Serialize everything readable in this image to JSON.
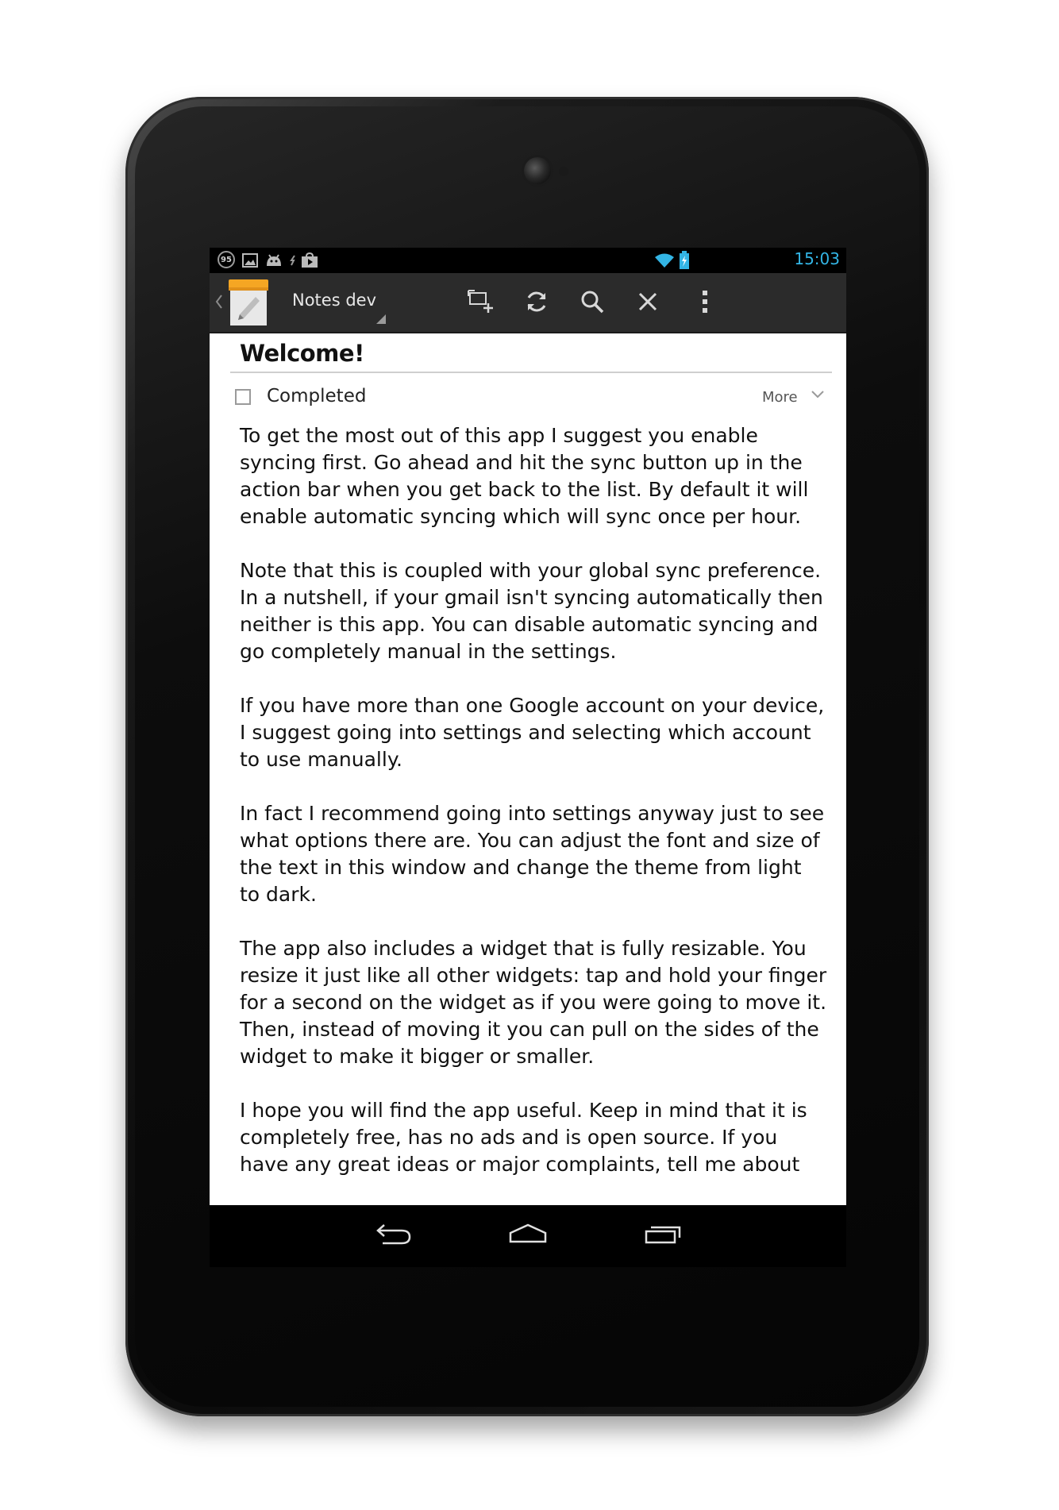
{
  "status_bar": {
    "notification_count": "95",
    "clock": "15:03",
    "icons": [
      "notification-count-icon",
      "image-icon",
      "android-icon",
      "usb-icon",
      "store-icon",
      "wifi-icon",
      "battery-charging-icon"
    ]
  },
  "action_bar": {
    "title": "Notes dev",
    "icons": [
      "back-chevron-icon",
      "notes-app-icon",
      "new-note-icon",
      "sync-icon",
      "search-icon",
      "close-icon",
      "overflow-menu-icon"
    ]
  },
  "note": {
    "title": "Welcome!",
    "completed_label": "Completed",
    "completed_checked": false,
    "more_label": "More",
    "paragraphs": [
      "To get the most out of this app I suggest you enable syncing first. Go ahead and hit the sync button up in the action bar when you get back to the list. By default it will enable automatic syncing which will sync once per hour.",
      "Note that this is coupled with your global sync preference. In a nutshell, if your gmail isn't syncing automatically then neither is this app. You can disable automatic syncing and go completely manual in the settings.",
      "If you have more than one Google account on your device, I suggest going into settings and selecting which account to use manually.",
      "In fact I recommend going into settings anyway just to see what options there are. You can adjust the font and size of the text in this window and change the theme from light to dark.",
      "The app also includes a widget that is fully resizable. You resize it just like all other widgets: tap and hold your finger for a second on the widget as if you were going to move it. Then, instead of moving it you can pull on the sides of the widget to make it bigger or smaller.",
      "I hope you will find the app useful. Keep in mind that it is completely free, has no ads and is open source. If you have any great ideas or major complaints, tell me about"
    ]
  },
  "nav_bar": {
    "icons": [
      "back-icon",
      "home-icon",
      "recent-apps-icon"
    ]
  },
  "colors": {
    "accent": "#33b5e5",
    "action_bar": "#2b2b2b",
    "logo_orange": "#f5a623"
  }
}
